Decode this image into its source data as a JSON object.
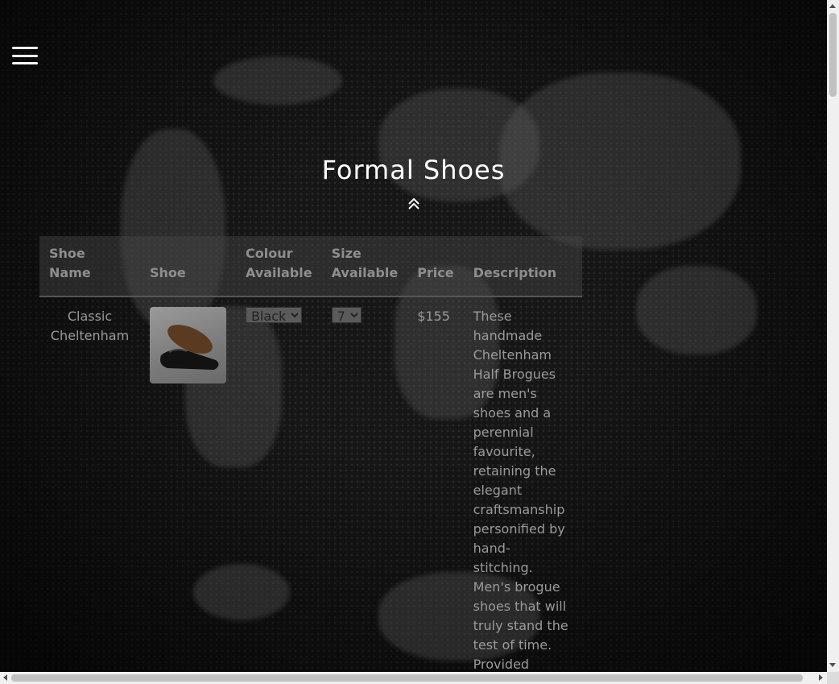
{
  "page": {
    "title": "Formal Shoes"
  },
  "table": {
    "headers": [
      "Shoe Name",
      "Shoe",
      "Colour Available",
      "Size Available",
      "Price",
      "Description"
    ],
    "rows": [
      {
        "name": "Classic Cheltenham",
        "colour_selected": "Black",
        "size_selected": "7",
        "price": "$155",
        "description": "These handmade Cheltenham Half Brogues are men's shoes and a perennial favourite, retaining the elegant craftsmanship personified by hand-stitching. Men's brogue shoes that will truly stand the test of time. Provided"
      }
    ]
  },
  "colors": {
    "background": "#161616",
    "title": "#ffffff",
    "text": "#9a9a9a"
  }
}
